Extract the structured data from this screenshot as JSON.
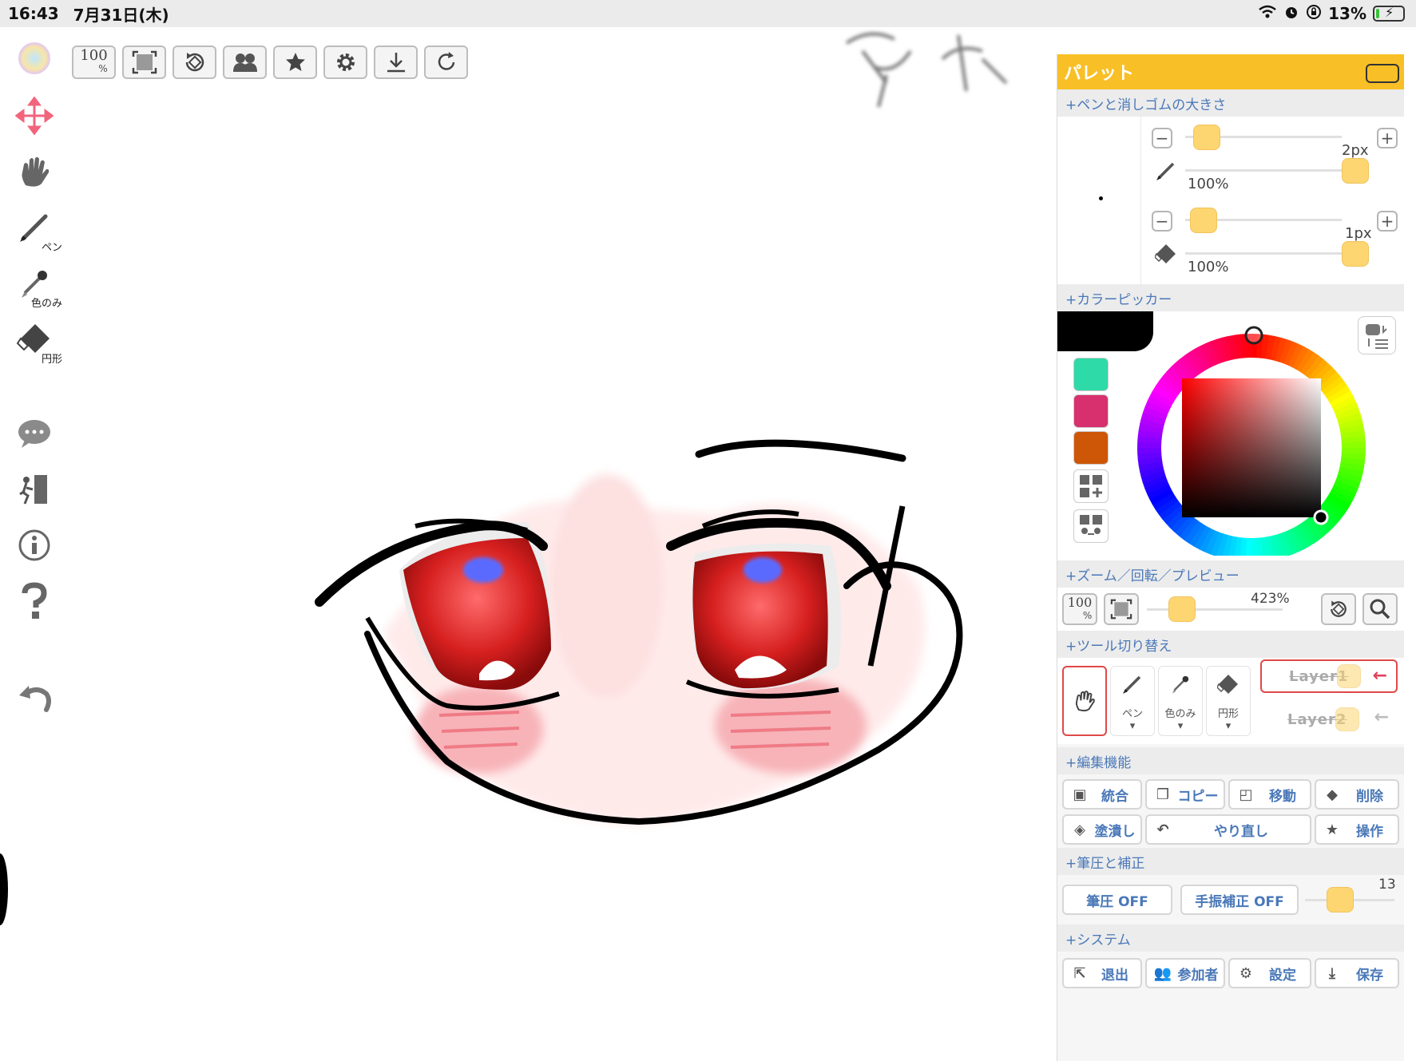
{
  "statusbar": {
    "time": "16:43",
    "date": "7月31日(木)",
    "battery": "13%",
    "battery_level": 0.13
  },
  "left_tools": {
    "pen": "ペン",
    "eyedropper": "色のみ",
    "eraser": "円形"
  },
  "topbar": {
    "zoom100_top": "100",
    "zoom100_bottom": "%"
  },
  "palette": {
    "title": "パレット",
    "sections": {
      "pen_eraser_size": "+ペンと消しゴムの大きさ",
      "color_picker": "+カラーピッカー",
      "zoom_rotate": "+ズーム／回転／プレビュー",
      "tool_switch": "+ツール切り替え",
      "edit": "+編集機能",
      "pressure": "+筆圧と補正",
      "system": "+システム"
    },
    "pen_size": {
      "value": "2px",
      "opacity": "100%",
      "size_level": 0.05,
      "opacity_level": 1.0
    },
    "eraser_size": {
      "value": "1px",
      "opacity": "100%",
      "size_level": 0.03,
      "opacity_level": 1.0
    },
    "colors": {
      "current": "#000000",
      "history": [
        "#2edaa7",
        "#d8306e",
        "#cd5607"
      ]
    },
    "zoom": {
      "zoom100_top": "100",
      "zoom100_bottom": "%",
      "value": "423%",
      "level": 0.2
    },
    "tools": {
      "pen": "ペン",
      "eyedropper": "色のみ",
      "eraser": "円形"
    },
    "layers": [
      "Layer1",
      "Layer2"
    ],
    "edit_buttons": {
      "merge": "統合",
      "copy": "コピー",
      "move": "移動",
      "delete": "削除",
      "fill": "塗潰し",
      "redo": "やり直し",
      "operation": "操作"
    },
    "pressure": {
      "pen_pressure": "筆圧 OFF",
      "stabilizer": "手振補正 OFF",
      "stabilizer_value": "13",
      "stabilizer_level": 0.35
    },
    "system_buttons": {
      "exit": "退出",
      "participants": "参加者",
      "settings": "設定",
      "save": "保存"
    },
    "accent": "#f8c026",
    "link_color": "#4a78b8"
  }
}
